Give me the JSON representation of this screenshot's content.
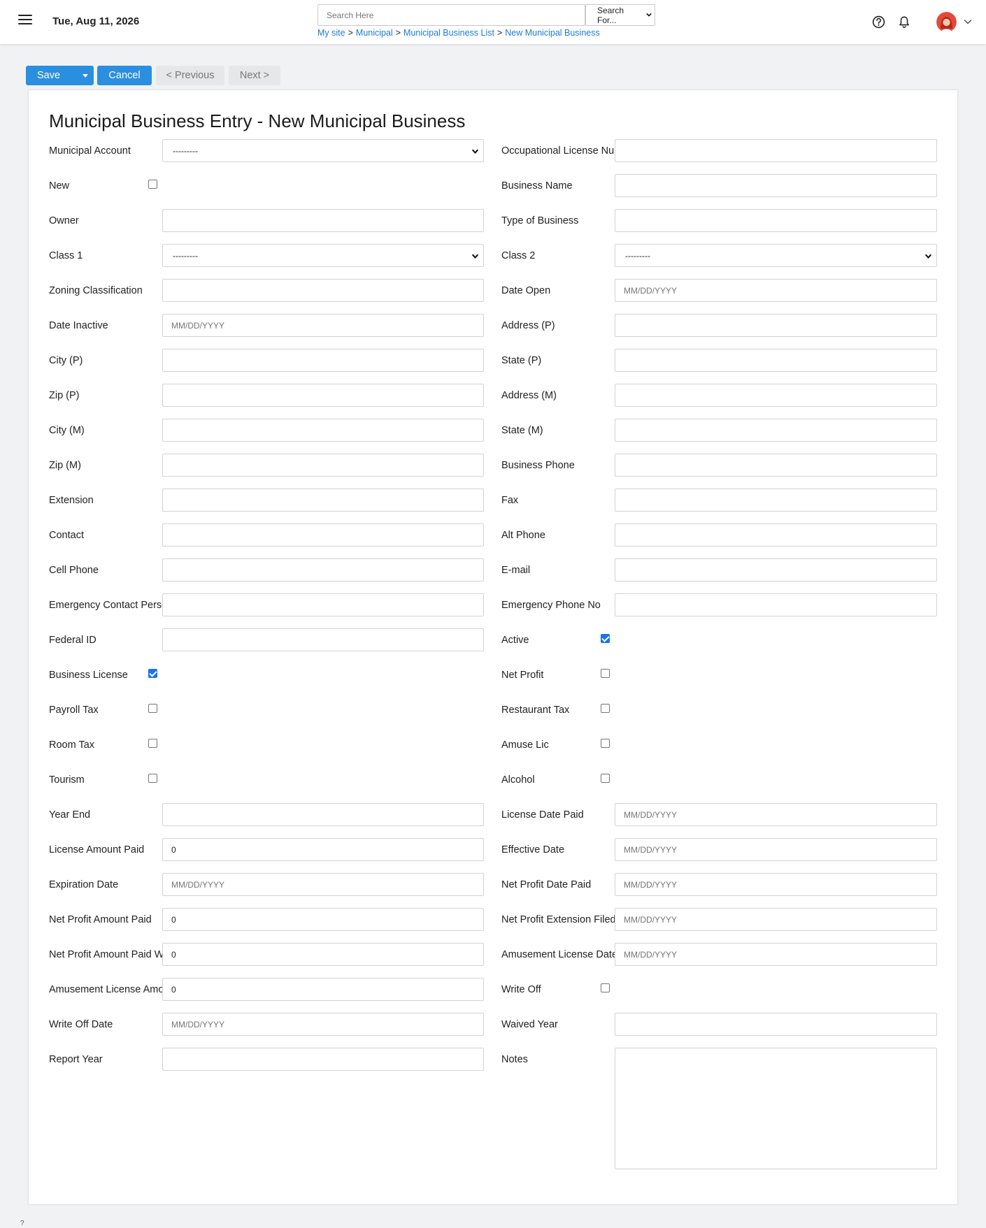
{
  "header": {
    "date": "Tue, Aug 11, 2026",
    "search_placeholder": "Search Here",
    "search_for": "Search For...",
    "breadcrumb": [
      "My site",
      "Municipal",
      "Municipal Business List",
      "New Municipal Business"
    ]
  },
  "toolbar": {
    "save": "Save",
    "cancel": "Cancel",
    "previous": "< Previous",
    "next": "Next >"
  },
  "form": {
    "title": "Municipal Business Entry - New Municipal Business",
    "date_placeholder": "MM/DD/YYYY",
    "select_default": "---------",
    "rows": [
      [
        {
          "label": "Municipal Account",
          "type": "select",
          "value": "---------"
        },
        {
          "label": "Occupational License Number",
          "type": "text",
          "value": ""
        }
      ],
      [
        {
          "label": "New",
          "type": "checkbox",
          "checked": false
        },
        {
          "label": "Business Name",
          "type": "text",
          "value": ""
        }
      ],
      [
        {
          "label": "Owner",
          "type": "text",
          "value": ""
        },
        {
          "label": "Type of Business",
          "type": "text",
          "value": ""
        }
      ],
      [
        {
          "label": "Class 1",
          "type": "select",
          "value": "---------"
        },
        {
          "label": "Class 2",
          "type": "select",
          "value": "---------"
        }
      ],
      [
        {
          "label": "Zoning Classification",
          "type": "text",
          "value": ""
        },
        {
          "label": "Date Open",
          "type": "date",
          "value": ""
        }
      ],
      [
        {
          "label": "Date Inactive",
          "type": "date",
          "value": ""
        },
        {
          "label": "Address (P)",
          "type": "text",
          "value": ""
        }
      ],
      [
        {
          "label": "City (P)",
          "type": "text",
          "value": ""
        },
        {
          "label": "State (P)",
          "type": "text",
          "value": ""
        }
      ],
      [
        {
          "label": "Zip (P)",
          "type": "text",
          "value": ""
        },
        {
          "label": "Address (M)",
          "type": "text",
          "value": ""
        }
      ],
      [
        {
          "label": "City (M)",
          "type": "text",
          "value": ""
        },
        {
          "label": "State (M)",
          "type": "text",
          "value": ""
        }
      ],
      [
        {
          "label": "Zip (M)",
          "type": "text",
          "value": ""
        },
        {
          "label": "Business Phone",
          "type": "text",
          "value": ""
        }
      ],
      [
        {
          "label": "Extension",
          "type": "text",
          "value": ""
        },
        {
          "label": "Fax",
          "type": "text",
          "value": ""
        }
      ],
      [
        {
          "label": "Contact",
          "type": "text",
          "value": ""
        },
        {
          "label": "Alt Phone",
          "type": "text",
          "value": ""
        }
      ],
      [
        {
          "label": "Cell Phone",
          "type": "text",
          "value": ""
        },
        {
          "label": "E-mail",
          "type": "text",
          "value": ""
        }
      ],
      [
        {
          "label": "Emergency Contact Person",
          "type": "text",
          "value": ""
        },
        {
          "label": "Emergency Phone No",
          "type": "text",
          "value": ""
        }
      ],
      [
        {
          "label": "Federal ID",
          "type": "text",
          "value": ""
        },
        {
          "label": "Active",
          "type": "checkbox",
          "checked": true
        }
      ],
      [
        {
          "label": "Business License",
          "type": "checkbox",
          "checked": true
        },
        {
          "label": "Net Profit",
          "type": "checkbox",
          "checked": false
        }
      ],
      [
        {
          "label": "Payroll Tax",
          "type": "checkbox",
          "checked": false
        },
        {
          "label": "Restaurant Tax",
          "type": "checkbox",
          "checked": false
        }
      ],
      [
        {
          "label": "Room Tax",
          "type": "checkbox",
          "checked": false
        },
        {
          "label": "Amuse Lic",
          "type": "checkbox",
          "checked": false
        }
      ],
      [
        {
          "label": "Tourism",
          "type": "checkbox",
          "checked": false
        },
        {
          "label": "Alcohol",
          "type": "checkbox",
          "checked": false
        }
      ],
      [
        {
          "label": "Year End",
          "type": "text",
          "value": ""
        },
        {
          "label": "License Date Paid",
          "type": "date",
          "value": ""
        }
      ],
      [
        {
          "label": "License Amount Paid",
          "type": "text",
          "value": "0"
        },
        {
          "label": "Effective Date",
          "type": "date",
          "value": ""
        }
      ],
      [
        {
          "label": "Expiration Date",
          "type": "date",
          "value": ""
        },
        {
          "label": "Net Profit Date Paid",
          "type": "date",
          "value": ""
        }
      ],
      [
        {
          "label": "Net Profit Amount Paid",
          "type": "text",
          "value": "0"
        },
        {
          "label": "Net Profit Extension Filed",
          "type": "date",
          "value": ""
        }
      ],
      [
        {
          "label": "Net Profit Amount Paid With Extension",
          "type": "text",
          "value": "0"
        },
        {
          "label": "Amusement License Date",
          "type": "date",
          "value": ""
        }
      ],
      [
        {
          "label": "Amusement License Amount",
          "type": "text",
          "value": "0"
        },
        {
          "label": "Write Off",
          "type": "checkbox",
          "checked": false
        }
      ],
      [
        {
          "label": "Write Off Date",
          "type": "date",
          "value": ""
        },
        {
          "label": "Waived Year",
          "type": "text",
          "value": ""
        }
      ],
      [
        {
          "label": "Report Year",
          "type": "text",
          "value": ""
        },
        {
          "label": "Notes",
          "type": "textarea",
          "value": ""
        }
      ]
    ]
  },
  "footer": {
    "mark": "?"
  }
}
